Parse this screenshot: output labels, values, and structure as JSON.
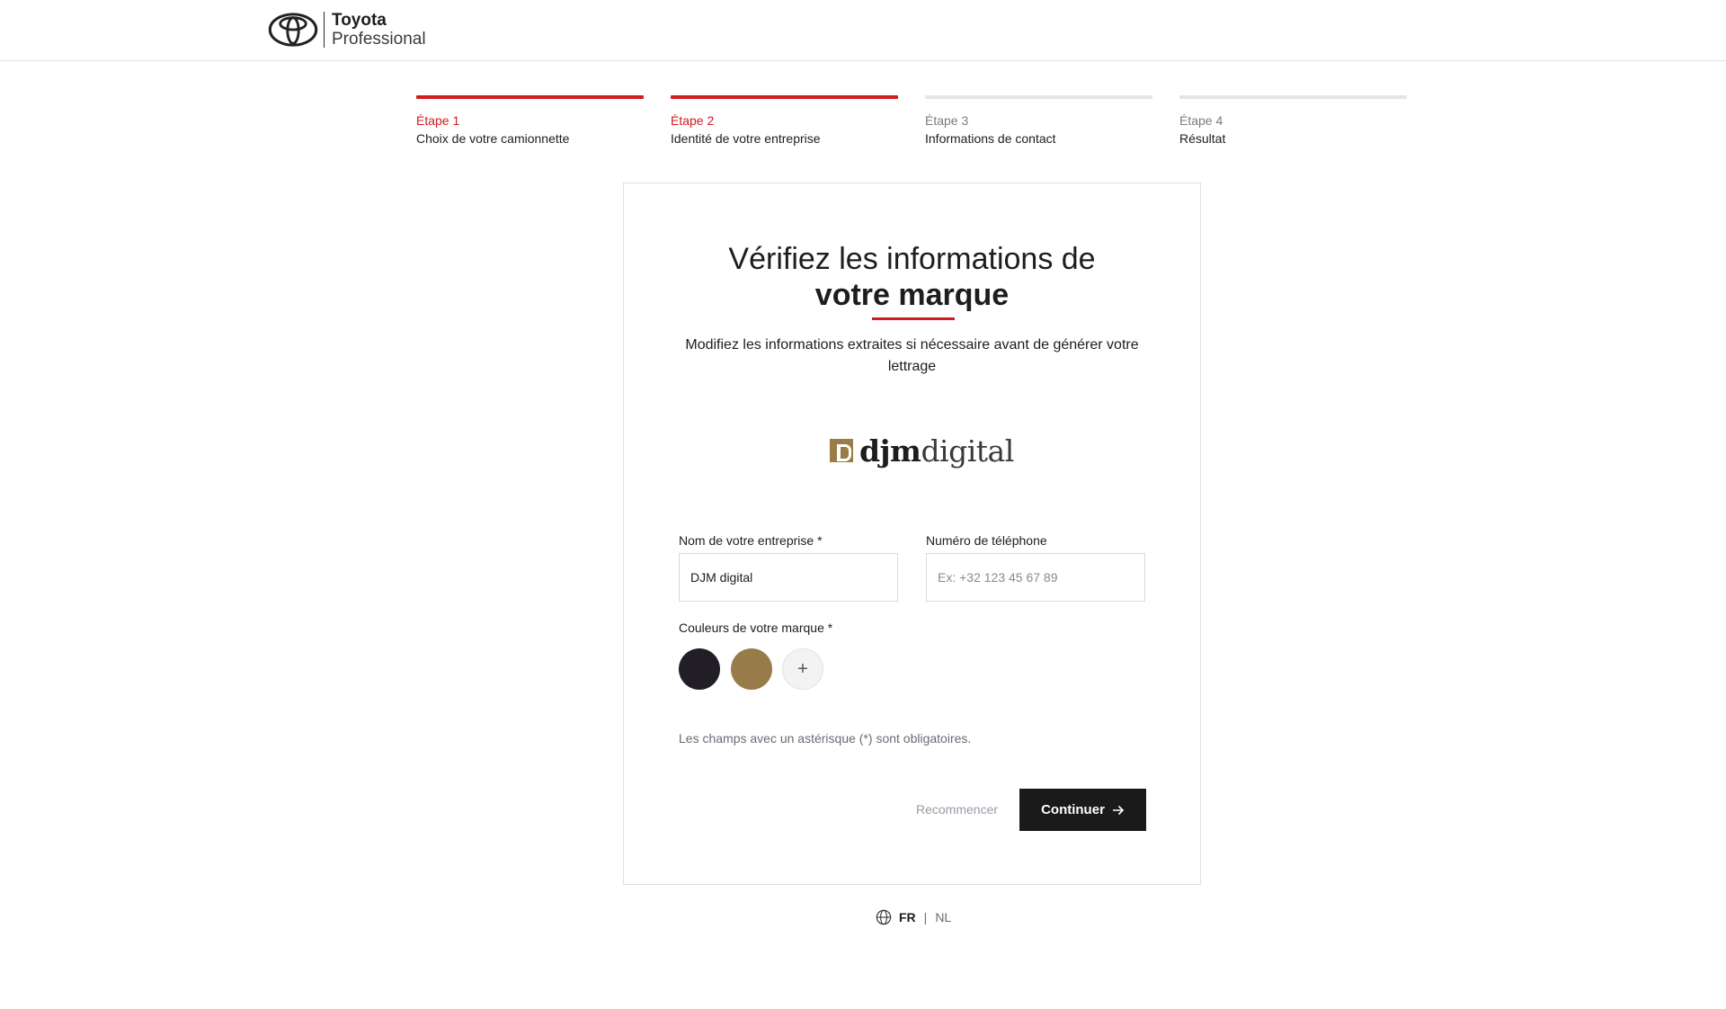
{
  "header": {
    "brand_line1": "Toyota",
    "brand_line2": "Professional"
  },
  "steps": [
    {
      "num": "Étape 1",
      "label": "Choix de votre camionnette",
      "active": true
    },
    {
      "num": "Étape 2",
      "label": "Identité de votre entreprise",
      "active": true
    },
    {
      "num": "Étape 3",
      "label": "Informations de contact",
      "active": false
    },
    {
      "num": "Étape 4",
      "label": "Résultat",
      "active": false
    }
  ],
  "card": {
    "title_line1": "Vérifiez les informations de",
    "title_line2": "votre marque",
    "subtitle": "Modifiez les informations extraites si nécessaire avant de générer votre lettrage",
    "company_logo_bold": "djm",
    "company_logo_regular": "digital",
    "company_name_label": "Nom de votre entreprise *",
    "company_name_value": "DJM digital",
    "phone_label": "Numéro de téléphone",
    "phone_placeholder": "Ex: +32 123 45 67 89",
    "colors_label": "Couleurs de votre marque *",
    "brand_colors": [
      "#221e26",
      "#977c4a"
    ],
    "add_color_symbol": "+",
    "required_note": "Les champs avec un astérisque (*) sont obligatoires.",
    "restart_label": "Recommencer",
    "continue_label": "Continuer"
  },
  "footer": {
    "lang_fr": "FR",
    "lang_sep": "|",
    "lang_nl": "NL"
  },
  "colors": {
    "accent": "#d01c20",
    "dark": "#1a1a1a"
  }
}
